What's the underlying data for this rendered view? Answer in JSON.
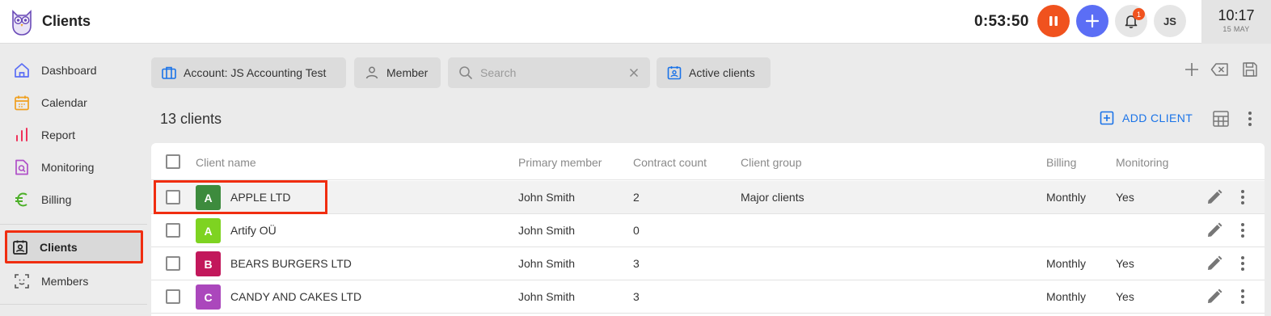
{
  "header": {
    "title": "Clients",
    "timer": "0:53:50",
    "notification_count": "1",
    "user_initials": "JS",
    "clock_time": "10:17",
    "clock_date": "15 MAY"
  },
  "colors": {
    "pause": "#f0521e",
    "add": "#5b6ef5",
    "accent_blue": "#1a73e8",
    "highlight_red": "#f02d10"
  },
  "sidebar": {
    "items": [
      {
        "label": "Dashboard",
        "icon": "home-icon"
      },
      {
        "label": "Calendar",
        "icon": "calendar-icon"
      },
      {
        "label": "Report",
        "icon": "bar-chart-icon"
      },
      {
        "label": "Monitoring",
        "icon": "document-search-icon"
      },
      {
        "label": "Billing",
        "icon": "euro-icon"
      },
      {
        "label": "Clients",
        "icon": "contact-card-icon",
        "active": true
      },
      {
        "label": "Members",
        "icon": "face-scan-icon"
      }
    ]
  },
  "filters": {
    "account": "Account: JS Accounting Test",
    "member": "Member",
    "search_placeholder": "Search",
    "active": "Active clients"
  },
  "list": {
    "count_title": "13 clients",
    "add_client_label": "ADD CLIENT"
  },
  "table": {
    "columns": [
      "Client name",
      "Primary member",
      "Contract count",
      "Client group",
      "Billing",
      "Monitoring"
    ],
    "rows": [
      {
        "letter": "A",
        "letter_color": "#3d8b3d",
        "name": "APPLE LTD",
        "member": "John Smith",
        "contracts": "2",
        "group": "Major clients",
        "billing": "Monthly",
        "monitoring": "Yes"
      },
      {
        "letter": "A",
        "letter_color": "#7ed321",
        "name": "Artify OÜ",
        "member": "John Smith",
        "contracts": "0",
        "group": "",
        "billing": "",
        "monitoring": ""
      },
      {
        "letter": "B",
        "letter_color": "#c2185b",
        "name": "BEARS BURGERS LTD",
        "member": "John Smith",
        "contracts": "3",
        "group": "",
        "billing": "Monthly",
        "monitoring": "Yes"
      },
      {
        "letter": "C",
        "letter_color": "#ab47bc",
        "name": "CANDY AND CAKES LTD",
        "member": "John Smith",
        "contracts": "3",
        "group": "",
        "billing": "Monthly",
        "monitoring": "Yes"
      }
    ]
  }
}
